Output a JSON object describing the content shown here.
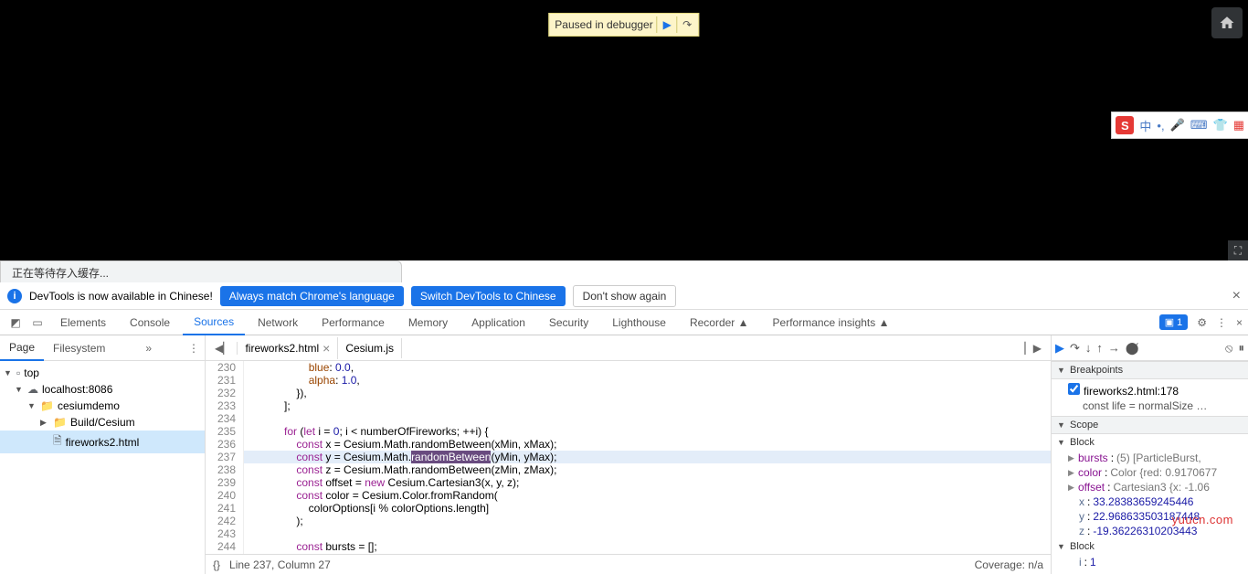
{
  "debugBadge": {
    "text": "Paused in debugger"
  },
  "loadingTab": "正在等待存入缓存...",
  "infoBar": {
    "msg": "DevTools is now available in Chinese!",
    "btn1": "Always match Chrome's language",
    "btn2": "Switch DevTools to Chinese",
    "btn3": "Don't show again"
  },
  "tabs": [
    "Elements",
    "Console",
    "Sources",
    "Network",
    "Performance",
    "Memory",
    "Application",
    "Security",
    "Lighthouse",
    "Recorder ▲",
    "Performance insights ▲"
  ],
  "activeTab": 2,
  "chatCount": "1",
  "leftTabs": [
    "Page",
    "Filesystem"
  ],
  "fileTree": {
    "top": "top",
    "host": "localhost:8086",
    "folder1": "cesiumdemo",
    "folder2": "Build/Cesium",
    "file": "fireworks2.html"
  },
  "openFiles": [
    "fireworks2.html",
    "Cesium.js"
  ],
  "gutter": [
    "230",
    "231",
    "232",
    "233",
    "234",
    "235",
    "236",
    "237",
    "238",
    "239",
    "240",
    "241",
    "242",
    "243",
    "244"
  ],
  "code": {
    "l230": "                    blue: 0.0,",
    "l231": "                    alpha: 1.0,",
    "l232": "                }),",
    "l233": "            ];",
    "l234": "",
    "l235p": "            for (let i = 0; i < numberOfFireworks; ++i) {",
    "l236a": "                const x = Cesium.Math.randomBetween(xMin, xMax);",
    "l237a": "                const y = Cesium.Math.",
    "l237m": "randomBetween",
    "l237b": "(yMin, yMax);",
    "l238a": "                const z = Cesium.Math.randomBetween(zMin, zMax);",
    "l239": "                const offset = new Cesium.Cartesian3(x, y, z);",
    "l240": "                const color = Cesium.Color.fromRandom(",
    "l241": "                    colorOptions[i % colorOptions.length]",
    "l242": "                );",
    "l243": "",
    "l244": "                const bursts = [];"
  },
  "status": {
    "pos": "Line 237, Column 27",
    "cov": "Coverage: n/a"
  },
  "sections": {
    "breakpoints": "Breakpoints",
    "scope": "Scope",
    "block": "Block"
  },
  "breakpoint": {
    "label": "fireworks2.html:178",
    "sub": "const life = normalSize …"
  },
  "scope": {
    "bursts": "bursts: (5) [ParticleBurst,",
    "color": "color: Color {red: 0.9170677",
    "offset": "offset: Cartesian3 {x: -1.06",
    "x": "x: 33.28383659245446",
    "y": "y: 22.968633503187448",
    "z": "z: -19.36226310203443",
    "i": "i: 1"
  },
  "watermark": "yuucn.com"
}
